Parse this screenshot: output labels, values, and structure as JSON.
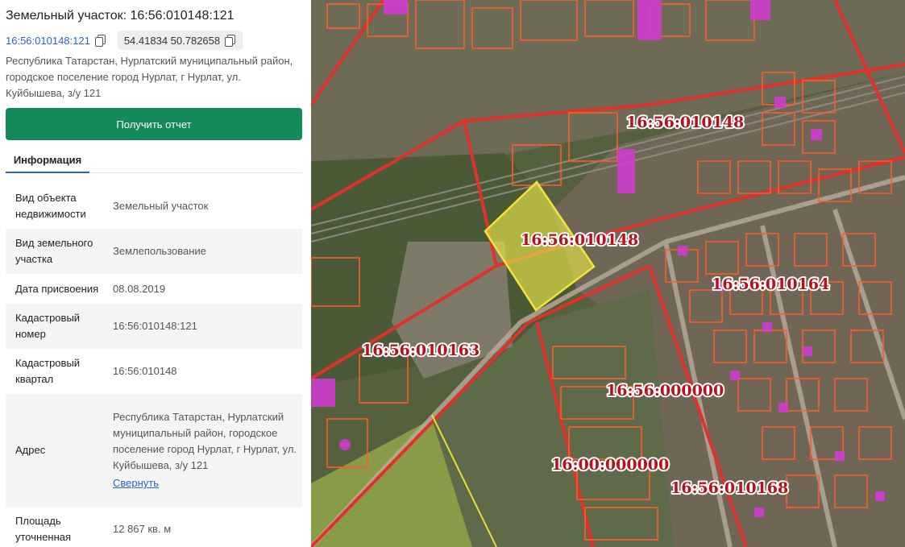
{
  "panel": {
    "title": "Земельный участок: 16:56:010148:121",
    "cadastral_link": "16:56:010148:121",
    "coordinates": "54.41834 50.782658",
    "address_line": "Республика Татарстан, Нурлатский муниципальный район, городское поселение город Нурлат, г Нурлат, ул. Куйбышева, з/у 121",
    "report_button": "Получить отчет",
    "tab_info": "Информация",
    "collapse_link": "Свернуть",
    "rows": [
      {
        "key": "Вид объекта недвижимости",
        "value": "Земельный участок"
      },
      {
        "key": "Вид земельного участка",
        "value": "Землепользование"
      },
      {
        "key": "Дата присвоения",
        "value": "08.08.2019"
      },
      {
        "key": "Кадастровый номер",
        "value": "16:56:010148:121"
      },
      {
        "key": "Кадастровый квартал",
        "value": "16:56:010148"
      },
      {
        "key": "Адрес",
        "value": "Республика Татарстан, Нурлатский муниципальный район, городское поселение город Нурлат, г Нурлат, ул. Куйбышева, з/у 121"
      },
      {
        "key": "Площадь уточненная",
        "value": "12 867 кв. м"
      }
    ]
  },
  "map": {
    "labels": [
      "16:56:010148",
      "16:56:010148",
      "16:56:010164",
      "16:56:010163",
      "16:56:000000",
      "16:00:000000",
      "16:56:010168"
    ],
    "colors": {
      "boundary": "#e0312b",
      "parcel": "#ff5a2a",
      "building": "#d63ad6",
      "selected_fill": "#e8e64a",
      "selected_stroke": "#f2e43a",
      "label": "#b5121b"
    }
  }
}
